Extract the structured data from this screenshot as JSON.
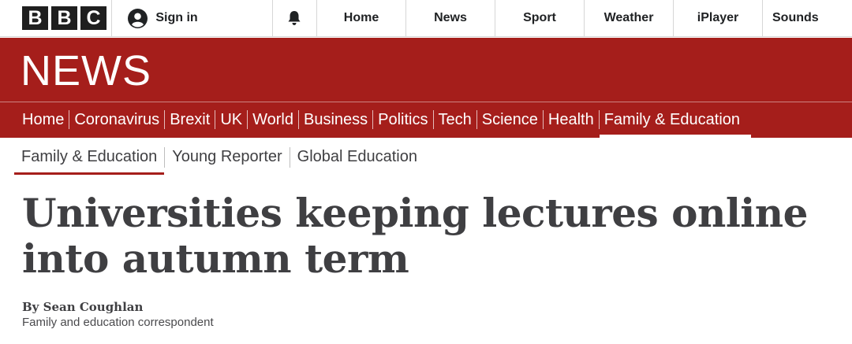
{
  "topbar": {
    "logo_letters": [
      "B",
      "B",
      "C"
    ],
    "signin_label": "Sign in",
    "notifications_icon": "bell-icon",
    "nav": [
      "Home",
      "News",
      "Sport",
      "Weather",
      "iPlayer",
      "Sounds"
    ]
  },
  "news": {
    "wordmark": "NEWS",
    "nav": [
      "Home",
      "Coronavirus",
      "Brexit",
      "UK",
      "World",
      "Business",
      "Politics",
      "Tech",
      "Science",
      "Health",
      "Family & Education"
    ],
    "active": "Family & Education"
  },
  "subnav": {
    "items": [
      "Family & Education",
      "Young Reporter",
      "Global Education"
    ],
    "active": "Family & Education"
  },
  "article": {
    "headline": "Universities keeping lectures online into autumn term",
    "byline": "By Sean Coughlan",
    "role": "Family and education correspondent"
  },
  "colors": {
    "news_red": "#a51e1b",
    "text": "#3f3f42",
    "logo_block": "#1f1f1f"
  }
}
